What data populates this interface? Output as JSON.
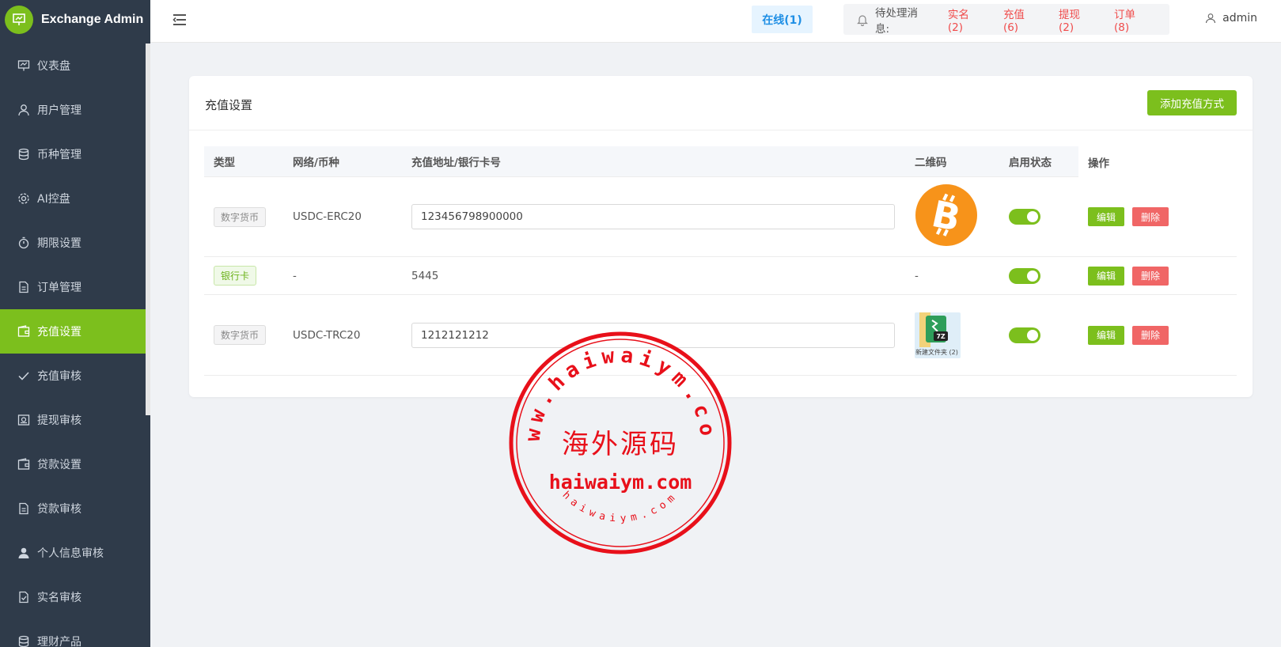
{
  "brand": {
    "title": "Exchange Admin"
  },
  "sidebar": {
    "items": [
      {
        "label": "仪表盘",
        "icon": "dashboard-icon"
      },
      {
        "label": "用户管理",
        "icon": "user-icon"
      },
      {
        "label": "币种管理",
        "icon": "database-icon"
      },
      {
        "label": "AI控盘",
        "icon": "gear-icon"
      },
      {
        "label": "期限设置",
        "icon": "stopwatch-icon"
      },
      {
        "label": "订单管理",
        "icon": "document-icon"
      },
      {
        "label": "充值设置",
        "icon": "wallet-icon"
      },
      {
        "label": "充值审核",
        "icon": "check-icon"
      },
      {
        "label": "提现审核",
        "icon": "withdraw-icon"
      },
      {
        "label": "贷款设置",
        "icon": "wallet-icon"
      },
      {
        "label": "贷款审核",
        "icon": "document-icon"
      },
      {
        "label": "个人信息审核",
        "icon": "person-icon"
      },
      {
        "label": "实名审核",
        "icon": "file-check-icon"
      },
      {
        "label": "理财产品",
        "icon": "database-icon"
      }
    ],
    "active_index": 6
  },
  "header": {
    "online": "在线(1)",
    "pending_label": "待处理消息:",
    "pending": [
      {
        "label": "实名(2)"
      },
      {
        "label": "充值(6)"
      },
      {
        "label": "提现(2)"
      },
      {
        "label": "订单(8)"
      }
    ],
    "user": "admin"
  },
  "card": {
    "title": "充值设置",
    "add_button": "添加充值方式"
  },
  "table": {
    "columns": {
      "type": "类型",
      "network": "网络/币种",
      "address": "充值地址/银行卡号",
      "qr": "二维码",
      "status": "启用状态",
      "ops": "操作"
    },
    "rows": [
      {
        "type": "数字货币",
        "network": "USDC-ERC20",
        "address": "123456798900000",
        "qr": "bitcoin",
        "enabled": true
      },
      {
        "type": "银行卡",
        "network": "-",
        "address": "5445",
        "qr": "-",
        "enabled": true
      },
      {
        "type": "数字货币",
        "network": "USDC-TRC20",
        "address": "1212121212",
        "qr": "file",
        "qr_caption": "新建文件夹 (2)",
        "enabled": true
      }
    ],
    "edit_label": "编辑",
    "delete_label": "删除"
  },
  "watermark": {
    "top_arc": "www.haiwaiym.com",
    "center": "海外源码",
    "url": "haiwaiym.com",
    "bottom_arc": "haiwaiym.com"
  },
  "colors": {
    "accent": "#7cbf1d",
    "sidebar_bg": "#2f3b4a",
    "danger": "#f06666",
    "stamp": "#e8101a"
  }
}
